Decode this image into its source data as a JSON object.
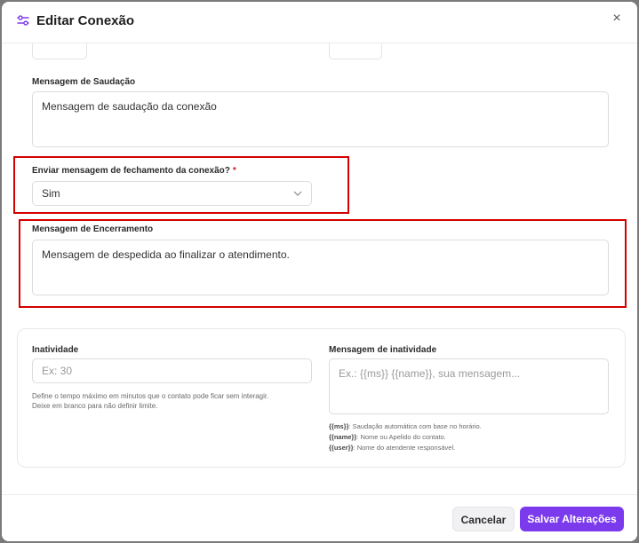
{
  "dialog": {
    "title": "Editar Conexão",
    "close_glyph": "×",
    "title_icon": "settings-sliders-icon"
  },
  "greeting": {
    "label": "Mensagem de Saudação",
    "value": "Mensagem de saudação da conexão"
  },
  "closing_toggle": {
    "label": "Enviar mensagem de fechamento da conexão?",
    "required_mark": "*",
    "selected": "Sim"
  },
  "closing_message": {
    "label": "Mensagem de Encerramento",
    "value": "Mensagem de despedida ao finalizar o atendimento."
  },
  "inactivity": {
    "label": "Inatividade",
    "placeholder": "Ex: 30",
    "help_line1": "Define o tempo máximo em minutos que o contato pode ficar sem interagir.",
    "help_line2": "Deixe em branco para não definir limite."
  },
  "inactivity_message": {
    "label": "Mensagem de inatividade",
    "placeholder": "Ex.: {{ms}} {{name}}, sua mensagem...",
    "vars": [
      {
        "token": "{{ms}}",
        "desc": ": Saudação automática com base no horário."
      },
      {
        "token": "{{name}}",
        "desc": ": Nome ou Apelido do contato."
      },
      {
        "token": "{{user}}",
        "desc": ": Nome do atendente responsável."
      }
    ]
  },
  "footer": {
    "cancel_label": "Cancelar",
    "save_label": "Salvar Alterações"
  },
  "colors": {
    "accent": "#7c3aed",
    "highlight": "#d40000",
    "required": "#d11a1a"
  }
}
